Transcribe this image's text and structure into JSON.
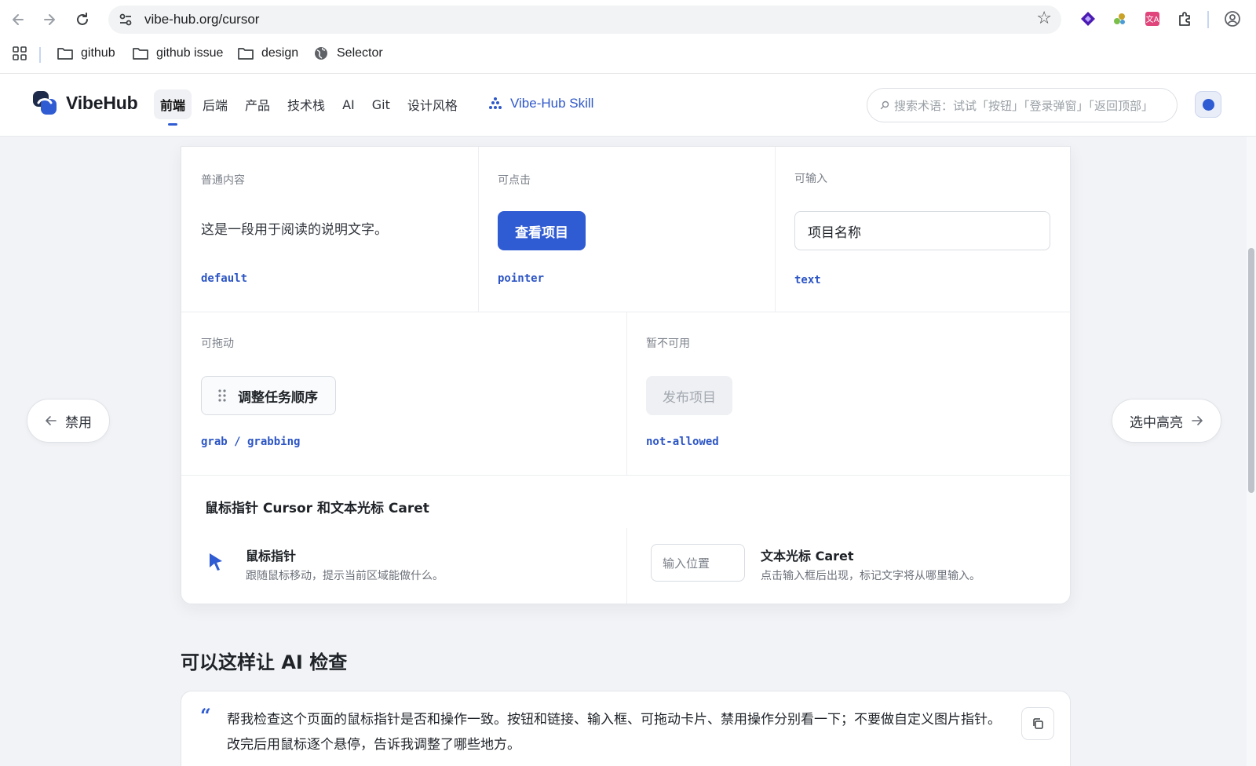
{
  "browser": {
    "url": "vibe-hub.org/cursor",
    "bookmarks": [
      {
        "label": "github",
        "icon": "folder-icon"
      },
      {
        "label": "github issue",
        "icon": "folder-icon"
      },
      {
        "label": "design",
        "icon": "folder-icon"
      },
      {
        "label": "Selector",
        "icon": "globe-icon"
      }
    ]
  },
  "site": {
    "logo_text": "VibeHub",
    "nav": [
      "前端",
      "后端",
      "产品",
      "技术栈",
      "AI",
      "Git",
      "设计风格"
    ],
    "active_nav": "前端",
    "skill_label": "Vibe-Hub Skill",
    "search_placeholder": "搜索术语：试试「按钮」「登录弹窗」「返回顶部」",
    "accent_color": "#2f5bd3"
  },
  "cursor_demo": {
    "default": {
      "label": "普通内容",
      "text": "这是一段用于阅读的说明文字。",
      "code": "default"
    },
    "pointer": {
      "label": "可点击",
      "button": "查看项目",
      "code": "pointer"
    },
    "text": {
      "label": "可输入",
      "input_value": "项目名称",
      "code": "text"
    },
    "grab": {
      "label": "可拖动",
      "card": "调整任务顺序",
      "code": "grab / grabbing"
    },
    "not_allowed": {
      "label": "暂不可用",
      "button": "发布项目",
      "code": "not-allowed"
    }
  },
  "cursor_caret": {
    "title": "鼠标指针 Cursor 和文本光标 Caret",
    "pointer_title": "鼠标指针",
    "pointer_desc": "跟随鼠标移动，提示当前区域能做什么。",
    "input_placeholder": "输入位置",
    "caret_title": "文本光标 Caret",
    "caret_desc": "点击输入框后出现，标记文字将从哪里输入。"
  },
  "side_nav": {
    "prev": "禁用",
    "next": "选中高亮"
  },
  "ai_check": {
    "heading": "可以这样让 AI 检查",
    "quote": "帮我检查这个页面的鼠标指针是否和操作一致。按钮和链接、输入框、可拖动卡片、禁用操作分别看一下；不要做自定义图片指针。改完后用鼠标逐个悬停，告诉我调整了哪些地方。"
  }
}
